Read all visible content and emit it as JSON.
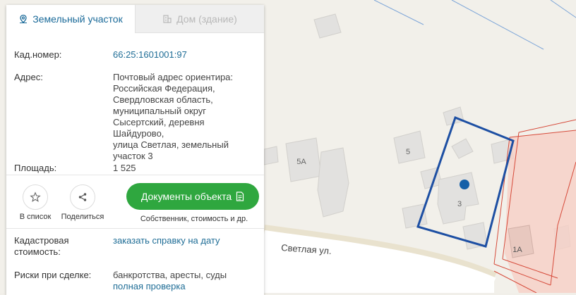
{
  "tabs": [
    {
      "label": "Земельный участок",
      "active": true,
      "icon": "map-pin-icon"
    },
    {
      "label": "Дом (здание)",
      "active": false,
      "icon": "building-icon"
    }
  ],
  "info": {
    "cadastral_label": "Кад.номер:",
    "cadastral_value": "66:25:1601001:97",
    "address_label": "Адрес:",
    "address_lines": [
      "Почтовый адрес ориентира:",
      "Российская Федерация,",
      "Свердловская область,",
      "муниципальный округ",
      "Сысертский, деревня Шайдурово,",
      "улица Светлая, земельный",
      "участок 3"
    ],
    "area_label": "Площадь:",
    "area_value": "1 525"
  },
  "actions": {
    "add_list_label": "В список",
    "share_label": "Поделиться",
    "docs_button_label": "Документы объекта",
    "docs_subtitle": "Собственник, стоимость и др."
  },
  "lower": {
    "cost_label_line1": "Кадастровая",
    "cost_label_line2": "стоимость:",
    "cost_link": "заказать справку на дату",
    "risks_label": "Риски при сделке:",
    "risks_value": "банкротства, аресты, суды",
    "risks_link": "полная проверка"
  },
  "map": {
    "street_label": "Светлая ул.",
    "house_labels": [
      "5А",
      "5",
      "3",
      "1А"
    ]
  },
  "colors": {
    "accent": "#1a6a99",
    "button_green": "#2fa73f",
    "parcel_outline": "#1d4fa3",
    "marker": "#1560a8",
    "neighbor_parcel": "#f4c7bd"
  }
}
